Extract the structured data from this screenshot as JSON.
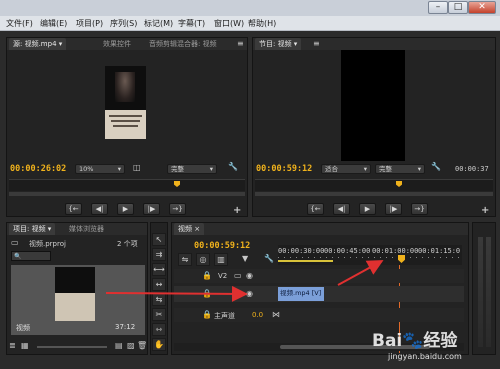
{
  "menu": [
    "文件(F)",
    "编辑(E)",
    "项目(P)",
    "序列(S)",
    "标记(M)",
    "字幕(T)",
    "窗口(W)",
    "帮助(H)"
  ],
  "window_buttons": [
    "–",
    "□",
    "✕"
  ],
  "source_panel": {
    "tabs": [
      "源: 视频.mp4 ▾",
      "效果控件",
      "音频剪辑混合器: 视频"
    ],
    "timecode": "00:00:26:02",
    "zoom": "10%",
    "quality": "完整"
  },
  "program_panel": {
    "tab": "节目: 视频 ▾",
    "timecode": "00:00:59:12",
    "zoom": "适合",
    "quality": "完整",
    "duration": "00:00:37"
  },
  "transport": [
    "{←",
    "◀|",
    "▶",
    "|▶",
    "→}"
  ],
  "project_panel": {
    "tabs": [
      "项目: 视频 ▾",
      "媒体浏览器"
    ],
    "file_name": "视频.prproj",
    "item_count": "2 个项",
    "thumb_label": "视频",
    "thumb_duration": "37:12"
  },
  "timeline": {
    "tab": "视频 ×",
    "timecode": "00:00:59:12",
    "ruler_ticks": [
      "00:00:30:00",
      "00:00:45:00",
      "00:01:00:00",
      "00:01:15:0"
    ],
    "tracks": [
      {
        "name": "V2"
      },
      {
        "name": "V1"
      },
      {
        "name": "主声道",
        "value": "0.0"
      }
    ],
    "clip_label": "视频.mp4 [V]"
  },
  "watermark": {
    "brand": "Bai🐾经验",
    "url": "jingyan.baidu.com"
  },
  "colors": {
    "accent_timecode": "#f0b21c",
    "playhead": "#e06a2a",
    "clip": "#7b9fd9",
    "arrow": "#e03030"
  }
}
